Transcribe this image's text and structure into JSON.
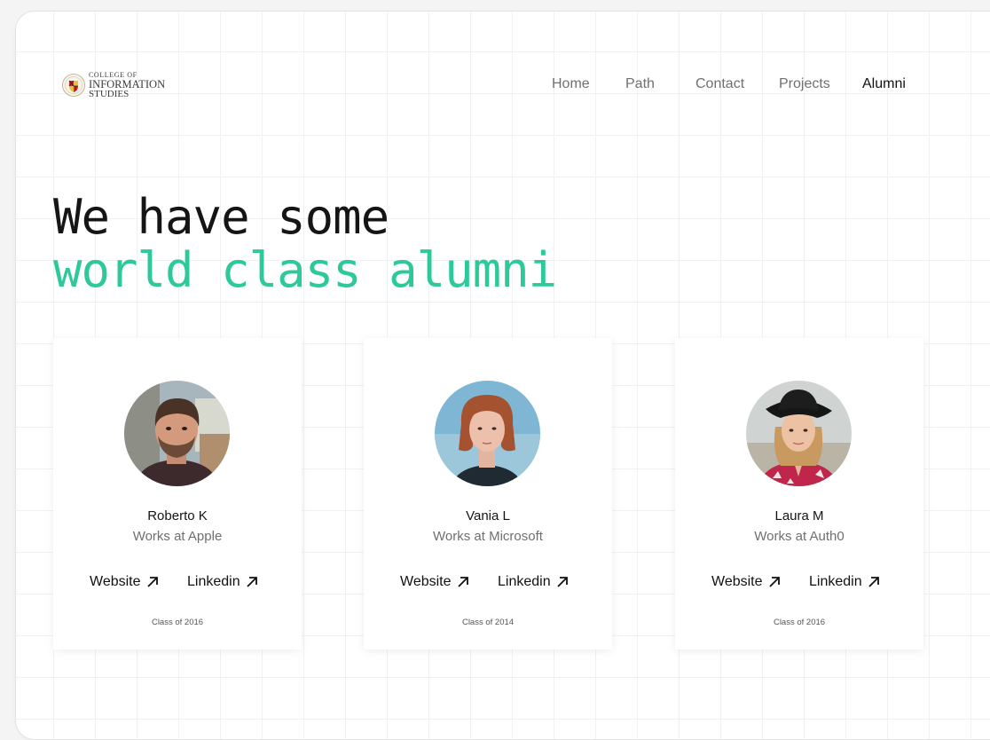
{
  "logo": {
    "line1": "COLLEGE OF",
    "line2": "INFORMATION",
    "line3": "STUDIES"
  },
  "nav": {
    "items": [
      {
        "label": "Home",
        "active": false
      },
      {
        "label": "Path",
        "active": false
      },
      {
        "label": "Contact",
        "active": false
      },
      {
        "label": "Projects",
        "active": false
      },
      {
        "label": "Alumni",
        "active": true
      }
    ]
  },
  "hero": {
    "line1": "We have some",
    "line2": "world class alumni"
  },
  "colors": {
    "accent": "#2dc99b",
    "text": "#151515",
    "muted": "#6f6f6f"
  },
  "alumni": [
    {
      "name": "Roberto K",
      "work": "Works at Apple",
      "website_label": "Website",
      "linkedin_label": "Linkedin",
      "class_year": "Class of 2016",
      "photo": "roberto-avatar"
    },
    {
      "name": "Vania L",
      "work": "Works at Microsoft",
      "website_label": "Website",
      "linkedin_label": "Linkedin",
      "class_year": "Class of 2014",
      "photo": "vania-avatar"
    },
    {
      "name": "Laura M",
      "work": "Works at Auth0",
      "website_label": "Website",
      "linkedin_label": "Linkedin",
      "class_year": "Class of 2016",
      "photo": "laura-avatar"
    }
  ],
  "icons": {
    "link_arrow": "arrow-up-right-icon",
    "logo_seal": "university-seal-icon"
  }
}
